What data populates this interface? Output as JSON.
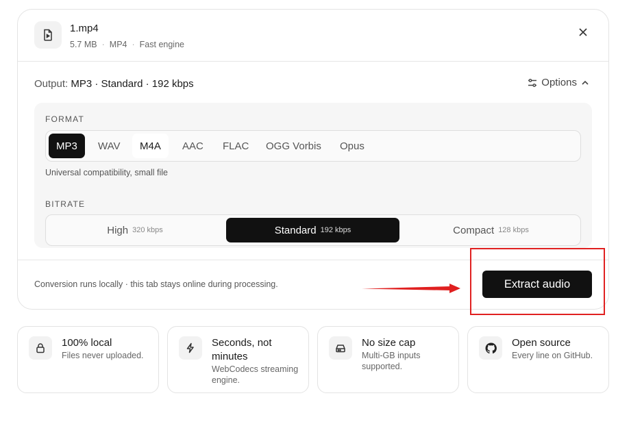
{
  "file": {
    "name": "1.mp4",
    "size": "5.7 MB",
    "container": "MP4",
    "engine": "Fast engine"
  },
  "output": {
    "label": "Output:",
    "summary": "MP3 · Standard · 192 kbps"
  },
  "options": {
    "label": "Options",
    "expanded": true
  },
  "format": {
    "section_label": "FORMAT",
    "options": [
      "MP3",
      "WAV",
      "M4A",
      "AAC",
      "FLAC",
      "OGG Vorbis",
      "Opus"
    ],
    "selected": "MP3",
    "description": "Universal compatibility, small file"
  },
  "bitrate": {
    "section_label": "BITRATE",
    "options": [
      {
        "label": "High",
        "kbps": "320 kbps"
      },
      {
        "label": "Standard",
        "kbps": "192 kbps"
      },
      {
        "label": "Compact",
        "kbps": "128 kbps"
      }
    ],
    "selected": "Standard"
  },
  "footer": {
    "note": "Conversion runs locally · this tab stays online during processing.",
    "extract_label": "Extract audio"
  },
  "features": [
    {
      "icon": "lock-icon",
      "title": "100% local",
      "desc": "Files never uploaded."
    },
    {
      "icon": "lightning-icon",
      "title": "Seconds, not minutes",
      "desc": "WebCodecs streaming engine."
    },
    {
      "icon": "drive-icon",
      "title": "No size cap",
      "desc": "Multi-GB inputs supported."
    },
    {
      "icon": "github-icon",
      "title": "Open source",
      "desc": "Every line on GitHub."
    }
  ],
  "colors": {
    "accent": "#111111",
    "annotation": "#e02020"
  }
}
